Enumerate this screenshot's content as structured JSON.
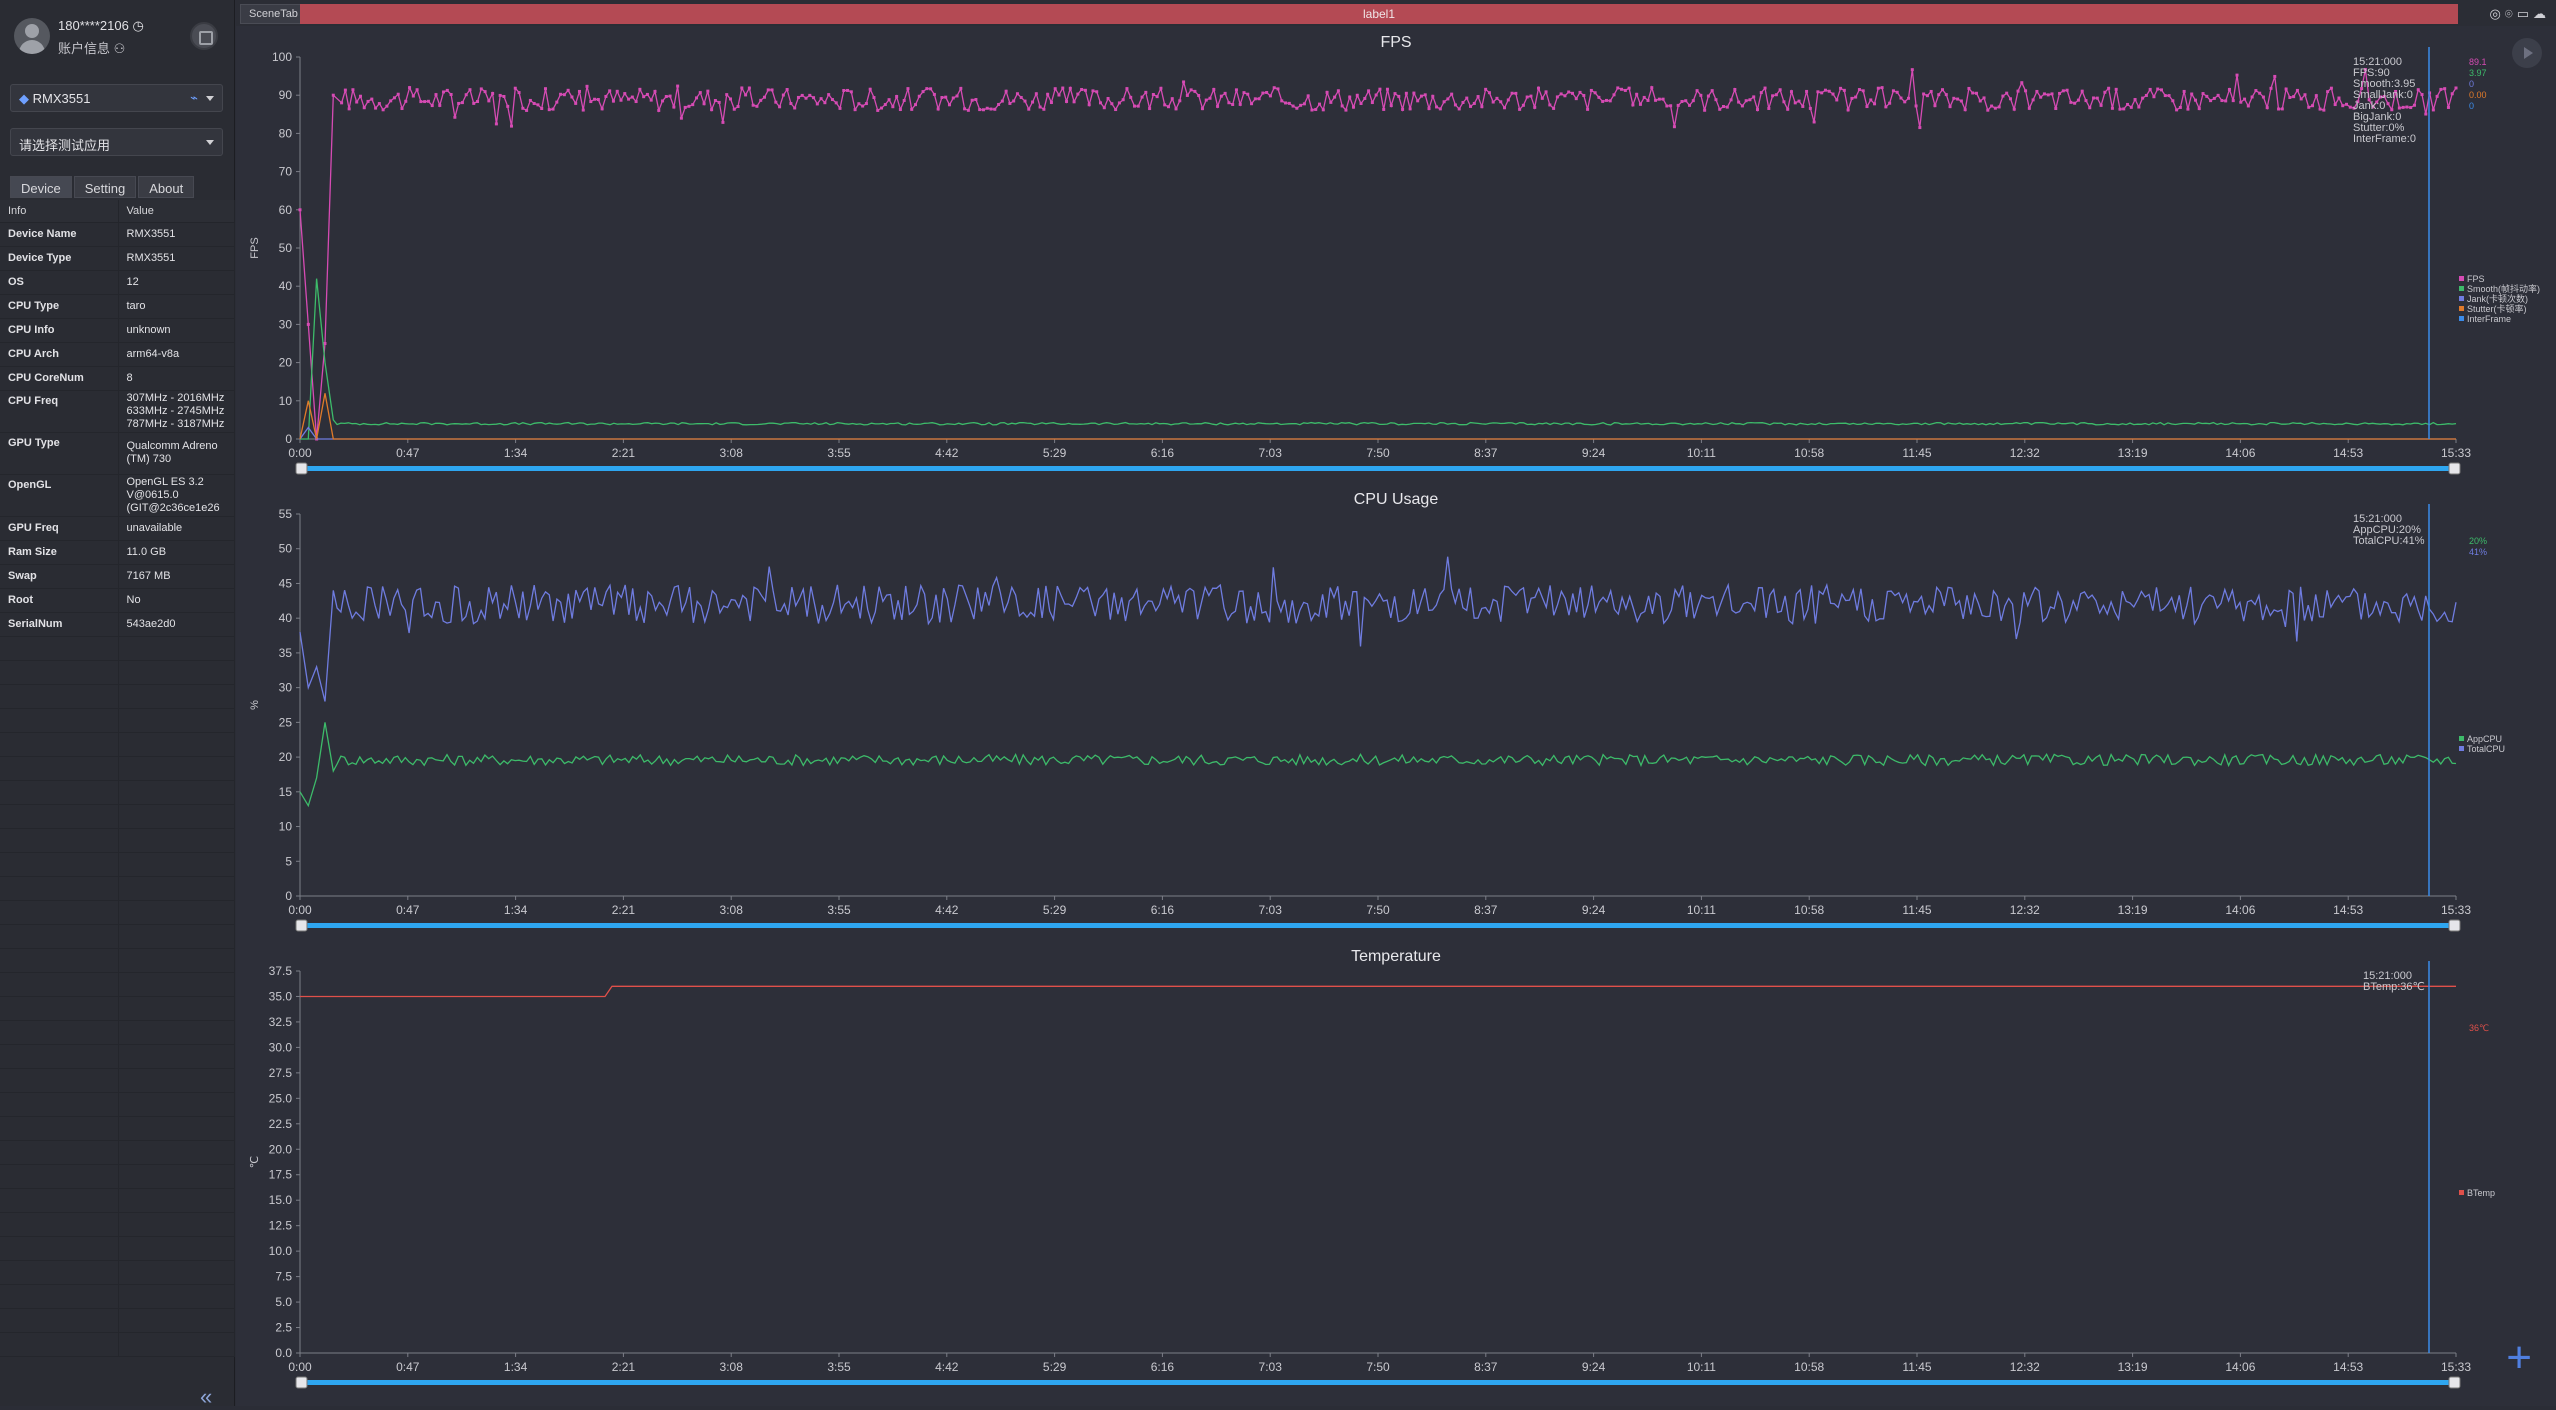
{
  "account": {
    "phone": "180****2106",
    "info_label": "账户信息"
  },
  "device_select": {
    "value": "RMX3551"
  },
  "app_select": {
    "placeholder": "请选择测试应用"
  },
  "tabs": [
    "Device",
    "Setting",
    "About"
  ],
  "info_table": {
    "headers": [
      "Info",
      "Value"
    ],
    "rows": [
      [
        "Device Name",
        "RMX3551"
      ],
      [
        "Device Type",
        "RMX3551"
      ],
      [
        "OS",
        "12"
      ],
      [
        "CPU Type",
        "taro"
      ],
      [
        "CPU Info",
        "unknown"
      ],
      [
        "CPU Arch",
        "arm64-v8a"
      ],
      [
        "CPU CoreNum",
        "8"
      ],
      [
        "CPU Freq",
        "307MHz - 2016MHz\n633MHz - 2745MHz\n787MHz - 3187MHz"
      ],
      [
        "GPU Type",
        "Qualcomm Adreno (TM) 730"
      ],
      [
        "OpenGL",
        "OpenGL ES 3.2 V@0615.0 (GIT@2c36ce1e26"
      ],
      [
        "GPU Freq",
        "unavailable"
      ],
      [
        "Ram Size",
        "11.0 GB"
      ],
      [
        "Swap",
        "7167 MB"
      ],
      [
        "Root",
        "No"
      ],
      [
        "SerialNum",
        "543ae2d0"
      ]
    ]
  },
  "topbar": {
    "scene_tab": "SceneTab",
    "label": "label1"
  },
  "x_ticks": [
    "0:00",
    "0:47",
    "1:34",
    "2:21",
    "3:08",
    "3:55",
    "4:42",
    "5:29",
    "6:16",
    "7:03",
    "7:50",
    "8:37",
    "9:24",
    "10:11",
    "10:58",
    "11:45",
    "12:32",
    "13:19",
    "14:06",
    "14:53",
    "15:33"
  ],
  "chart_data": [
    {
      "type": "line",
      "title": "FPS",
      "ylabel": "FPS",
      "ylim": [
        0,
        100
      ],
      "y_ticks": [
        0,
        10,
        20,
        30,
        40,
        50,
        60,
        70,
        80,
        90,
        100
      ],
      "tooltip": [
        "15:21:000",
        "FPS:90",
        "Smooth:3.95",
        "SmallJank:0",
        "Jank:0",
        "BigJank:0",
        "Stutter:0%",
        "InterFrame:0"
      ],
      "side_values": [
        {
          "text": "89.1",
          "color": "#d64bb4"
        },
        {
          "text": "3.97",
          "color": "#3dbb6a"
        },
        {
          "text": "0",
          "color": "#6f7ce0"
        },
        {
          "text": "0.00",
          "color": "#e07a2a"
        },
        {
          "text": "0",
          "color": "#3b8be8"
        }
      ],
      "legend": [
        {
          "name": "FPS",
          "color": "#d64bb4"
        },
        {
          "name": "Smooth(帧抖动率)",
          "color": "#3dbb6a"
        },
        {
          "name": "Jank(卡顿次数)",
          "color": "#6f7ce0"
        },
        {
          "name": "Stutter(卡顿率)",
          "color": "#e07a2a"
        },
        {
          "name": "InterFrame",
          "color": "#3b8be8"
        }
      ],
      "series": [
        {
          "name": "FPS",
          "color": "#d64bb4",
          "start": [
            60,
            30,
            0,
            25,
            90,
            88
          ],
          "base": 89,
          "noise": 3
        },
        {
          "name": "Smooth",
          "color": "#3dbb6a",
          "start": [
            0,
            0,
            42,
            20,
            5
          ],
          "base": 4,
          "noise": 0.3
        },
        {
          "name": "Jank",
          "color": "#6f7ce0",
          "start": [
            0,
            3,
            0
          ],
          "base": 0,
          "noise": 0
        },
        {
          "name": "Stutter",
          "color": "#e07a2a",
          "start": [
            0,
            10,
            0,
            12,
            0
          ],
          "base": 0,
          "noise": 0
        }
      ]
    },
    {
      "type": "line",
      "title": "CPU Usage",
      "ylabel": "%",
      "ylim": [
        0,
        55
      ],
      "y_ticks": [
        0,
        5,
        10,
        15,
        20,
        25,
        30,
        35,
        40,
        45,
        50,
        55
      ],
      "tooltip": [
        "15:21:000",
        "AppCPU:20%",
        "TotalCPU:41%"
      ],
      "side_values": [
        {
          "text": "20%",
          "color": "#3dbb6a"
        },
        {
          "text": "41%",
          "color": "#6f7ce0"
        }
      ],
      "legend": [
        {
          "name": "AppCPU",
          "color": "#3dbb6a"
        },
        {
          "name": "TotalCPU",
          "color": "#6f7ce0"
        }
      ],
      "series": [
        {
          "name": "AppCPU",
          "color": "#3dbb6a",
          "start": [
            15,
            13,
            17,
            25,
            18
          ],
          "base": 19.6,
          "noise": 0.8
        },
        {
          "name": "TotalCPU",
          "color": "#6f7ce0",
          "start": [
            38,
            30,
            33,
            28,
            44
          ],
          "base": 42,
          "noise": 2.8
        }
      ]
    },
    {
      "type": "line",
      "title": "Temperature",
      "ylabel": "℃",
      "ylim": [
        0,
        37.5
      ],
      "y_ticks": [
        0.0,
        2.5,
        5.0,
        7.5,
        10.0,
        12.5,
        15.0,
        17.5,
        20.0,
        22.5,
        25.0,
        27.5,
        30.0,
        32.5,
        35.0,
        37.5
      ],
      "tooltip": [
        "15:21:000",
        "BTemp:36℃"
      ],
      "side_values": [
        {
          "text": "36℃",
          "color": "#e0504a"
        }
      ],
      "legend": [
        {
          "name": "BTemp",
          "color": "#e0504a"
        }
      ],
      "series": [
        {
          "name": "BTemp",
          "color": "#e0504a",
          "steps": [
            [
              0,
              35
            ],
            [
              2.2,
              35
            ],
            [
              2.25,
              36
            ],
            [
              15.55,
              36
            ]
          ]
        }
      ]
    }
  ]
}
